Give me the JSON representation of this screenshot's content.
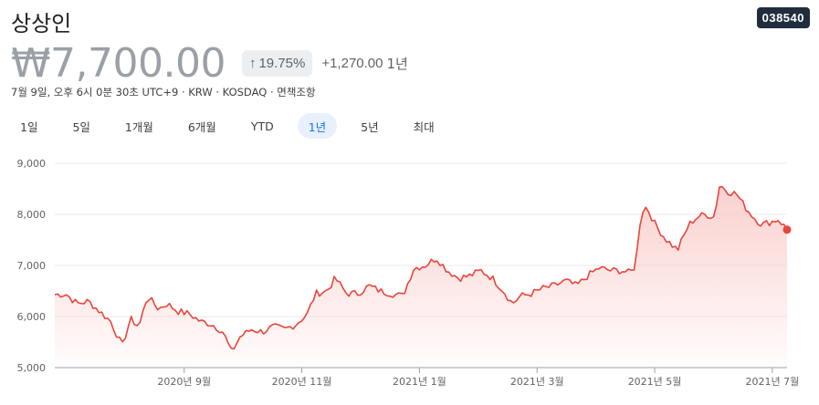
{
  "header": {
    "title": "상상인",
    "ticker": "038540",
    "price": "₩7,700.00",
    "change_pct": "19.75%",
    "change_arrow": "↑",
    "change_abs": "+1,270.00",
    "change_period": "1년",
    "meta": "7월 9일, 오후 6시 0분 30초 UTC+9 · KRW · KOSDAQ · 면책조항"
  },
  "tabs": [
    {
      "label": "1일",
      "active": false
    },
    {
      "label": "5일",
      "active": false
    },
    {
      "label": "1개월",
      "active": false
    },
    {
      "label": "6개월",
      "active": false
    },
    {
      "label": "YTD",
      "active": false
    },
    {
      "label": "1년",
      "active": true
    },
    {
      "label": "5년",
      "active": false
    },
    {
      "label": "최대",
      "active": false
    }
  ],
  "colors": {
    "line": "#e8453c",
    "fill_top": "#f9c9c6",
    "grid": "#e8eaed",
    "active_tab_bg": "#e8f0fe",
    "active_tab_text": "#1a73e8"
  },
  "chart_data": {
    "type": "area",
    "y_ticks": [
      "9,000",
      "8,000",
      "7,000",
      "6,000",
      "5,000"
    ],
    "ylim": [
      5000,
      9000
    ],
    "x_ticks": [
      {
        "label": "2020년 9월",
        "index": 44
      },
      {
        "label": "2020년 11월",
        "index": 84
      },
      {
        "label": "2021년 1월",
        "index": 124
      },
      {
        "label": "2021년 3월",
        "index": 164
      },
      {
        "label": "2021년 5월",
        "index": 204
      },
      {
        "label": "2021년 7월",
        "index": 244
      }
    ],
    "n_points": 250,
    "keypoints": [
      [
        0,
        6430
      ],
      [
        4,
        6440
      ],
      [
        8,
        6250
      ],
      [
        12,
        6300
      ],
      [
        16,
        6100
      ],
      [
        20,
        5900
      ],
      [
        24,
        5420
      ],
      [
        27,
        5950
      ],
      [
        30,
        5800
      ],
      [
        33,
        6400
      ],
      [
        37,
        6150
      ],
      [
        40,
        6250
      ],
      [
        44,
        6100
      ],
      [
        48,
        6050
      ],
      [
        52,
        5900
      ],
      [
        56,
        5850
      ],
      [
        60,
        5700
      ],
      [
        63,
        5300
      ],
      [
        66,
        5600
      ],
      [
        70,
        5750
      ],
      [
        74,
        5700
      ],
      [
        78,
        5800
      ],
      [
        82,
        5750
      ],
      [
        86,
        5850
      ],
      [
        90,
        6050
      ],
      [
        93,
        6450
      ],
      [
        97,
        6500
      ],
      [
        100,
        6750
      ],
      [
        104,
        6450
      ],
      [
        108,
        6450
      ],
      [
        112,
        6600
      ],
      [
        116,
        6500
      ],
      [
        120,
        6450
      ],
      [
        124,
        6400
      ],
      [
        128,
        6950
      ],
      [
        132,
        7000
      ],
      [
        136,
        7150
      ],
      [
        140,
        6900
      ],
      [
        144,
        6750
      ],
      [
        148,
        6800
      ],
      [
        152,
        6900
      ],
      [
        156,
        6750
      ],
      [
        160,
        6500
      ],
      [
        163,
        6250
      ],
      [
        166,
        6400
      ],
      [
        170,
        6450
      ],
      [
        174,
        6550
      ],
      [
        178,
        6600
      ],
      [
        182,
        6700
      ],
      [
        186,
        6600
      ],
      [
        190,
        6800
      ],
      [
        194,
        6950
      ],
      [
        198,
        6900
      ],
      [
        202,
        6900
      ],
      [
        205,
        6850
      ],
      [
        207,
        7000
      ],
      [
        209,
        8050
      ],
      [
        211,
        8150
      ],
      [
        214,
        7800
      ],
      [
        218,
        7500
      ],
      [
        222,
        7300
      ],
      [
        226,
        7800
      ],
      [
        229,
        7950
      ],
      [
        232,
        8000
      ],
      [
        235,
        7950
      ],
      [
        237,
        8580
      ],
      [
        240,
        8450
      ],
      [
        243,
        8400
      ],
      [
        246,
        8150
      ],
      [
        249,
        7950
      ],
      [
        252,
        7800
      ],
      [
        255,
        7850
      ],
      [
        258,
        7900
      ],
      [
        261,
        7700
      ]
    ],
    "last_value": 7700
  }
}
